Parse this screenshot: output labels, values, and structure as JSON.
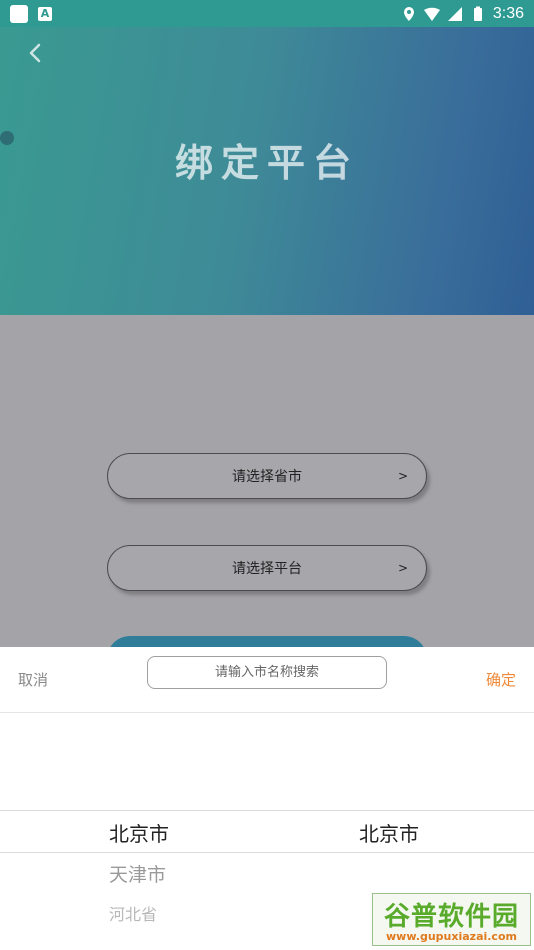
{
  "status_bar": {
    "time": "3:36",
    "icons": [
      "app-square-icon",
      "a-notification-icon",
      "location-icon",
      "wifi-icon",
      "signal-icon",
      "battery-icon"
    ]
  },
  "header": {
    "title": "绑定平台",
    "back_icon": "chevron-left-icon"
  },
  "form": {
    "province_label": "请选择省市",
    "province_arrow": ">",
    "platform_label": "请选择平台",
    "platform_arrow": ">"
  },
  "picker": {
    "cancel_label": "取消",
    "confirm_label": "确定",
    "search_placeholder": "请输入市名称搜索",
    "provinces": [
      "北京市",
      "天津市",
      "河北省"
    ],
    "cities": [
      "北京市"
    ]
  },
  "watermark": {
    "brand": "谷普软件园",
    "url": "www.gupuxiazai.com"
  },
  "colors": {
    "accent_orange": "#f08a3a",
    "header_teal": "#3a9a91",
    "header_blue": "#2f5f95"
  }
}
